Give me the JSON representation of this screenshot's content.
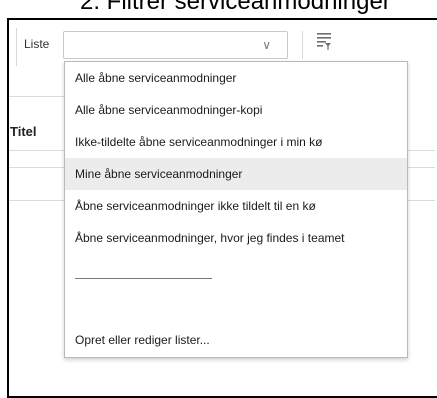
{
  "heading": "2.   Filtrer serviceanmodninger",
  "toolbar": {
    "list_label": "Liste",
    "select_value": "",
    "chevron": "∨"
  },
  "table": {
    "title_header": "Titel"
  },
  "menu": {
    "items": [
      {
        "label": "Alle åbne serviceanmodninger"
      },
      {
        "label": "Alle åbne serviceanmodninger-kopi"
      },
      {
        "label": "Ikke-tildelte åbne serviceanmodninger i min kø"
      },
      {
        "label": "Mine åbne serviceanmodninger",
        "highlighted": true
      },
      {
        "label": "Åbne serviceanmodninger ikke tildelt til en kø"
      },
      {
        "label": "Åbne serviceanmodninger, hvor jeg findes i teamet"
      }
    ],
    "footer_item": "Opret eller rediger lister..."
  },
  "icons": {
    "dropdown": "chevron-down-icon",
    "filter": "filter-list-icon"
  },
  "colors": {
    "hover_bg": "#ececec",
    "border": "#b9b9b9",
    "text": "#1a1a1a"
  }
}
